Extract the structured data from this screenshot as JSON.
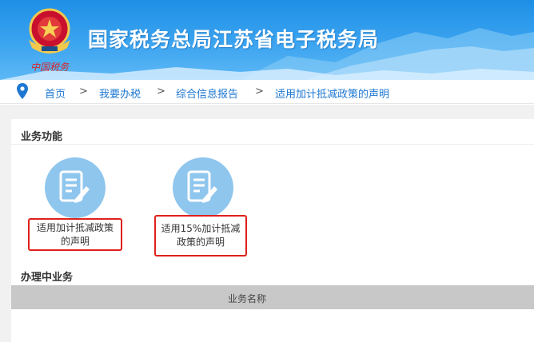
{
  "header": {
    "site_title": "国家税务总局江苏省电子税务局",
    "emblem_caption": "中国税务"
  },
  "breadcrumb": {
    "items": [
      "首页",
      "我要办税",
      "综合信息报告",
      "适用加计抵减政策的声明"
    ],
    "separator": ">"
  },
  "business_functions": {
    "title": "业务功能",
    "items": [
      {
        "label_line1": "适用加计抵减政策",
        "label_line2": "的声明",
        "icon": "document-edit-icon"
      },
      {
        "label_line1": "适用15%加计抵减",
        "label_line2": "政策的声明",
        "icon": "document-edit-icon"
      }
    ]
  },
  "in_progress": {
    "title": "办理中业务",
    "columns": [
      "业务名称"
    ]
  },
  "colors": {
    "banner": "#2b98ea",
    "icon_circle": "#8fc6ee",
    "highlight_border": "#e0201b",
    "link": "#1e78d2"
  }
}
